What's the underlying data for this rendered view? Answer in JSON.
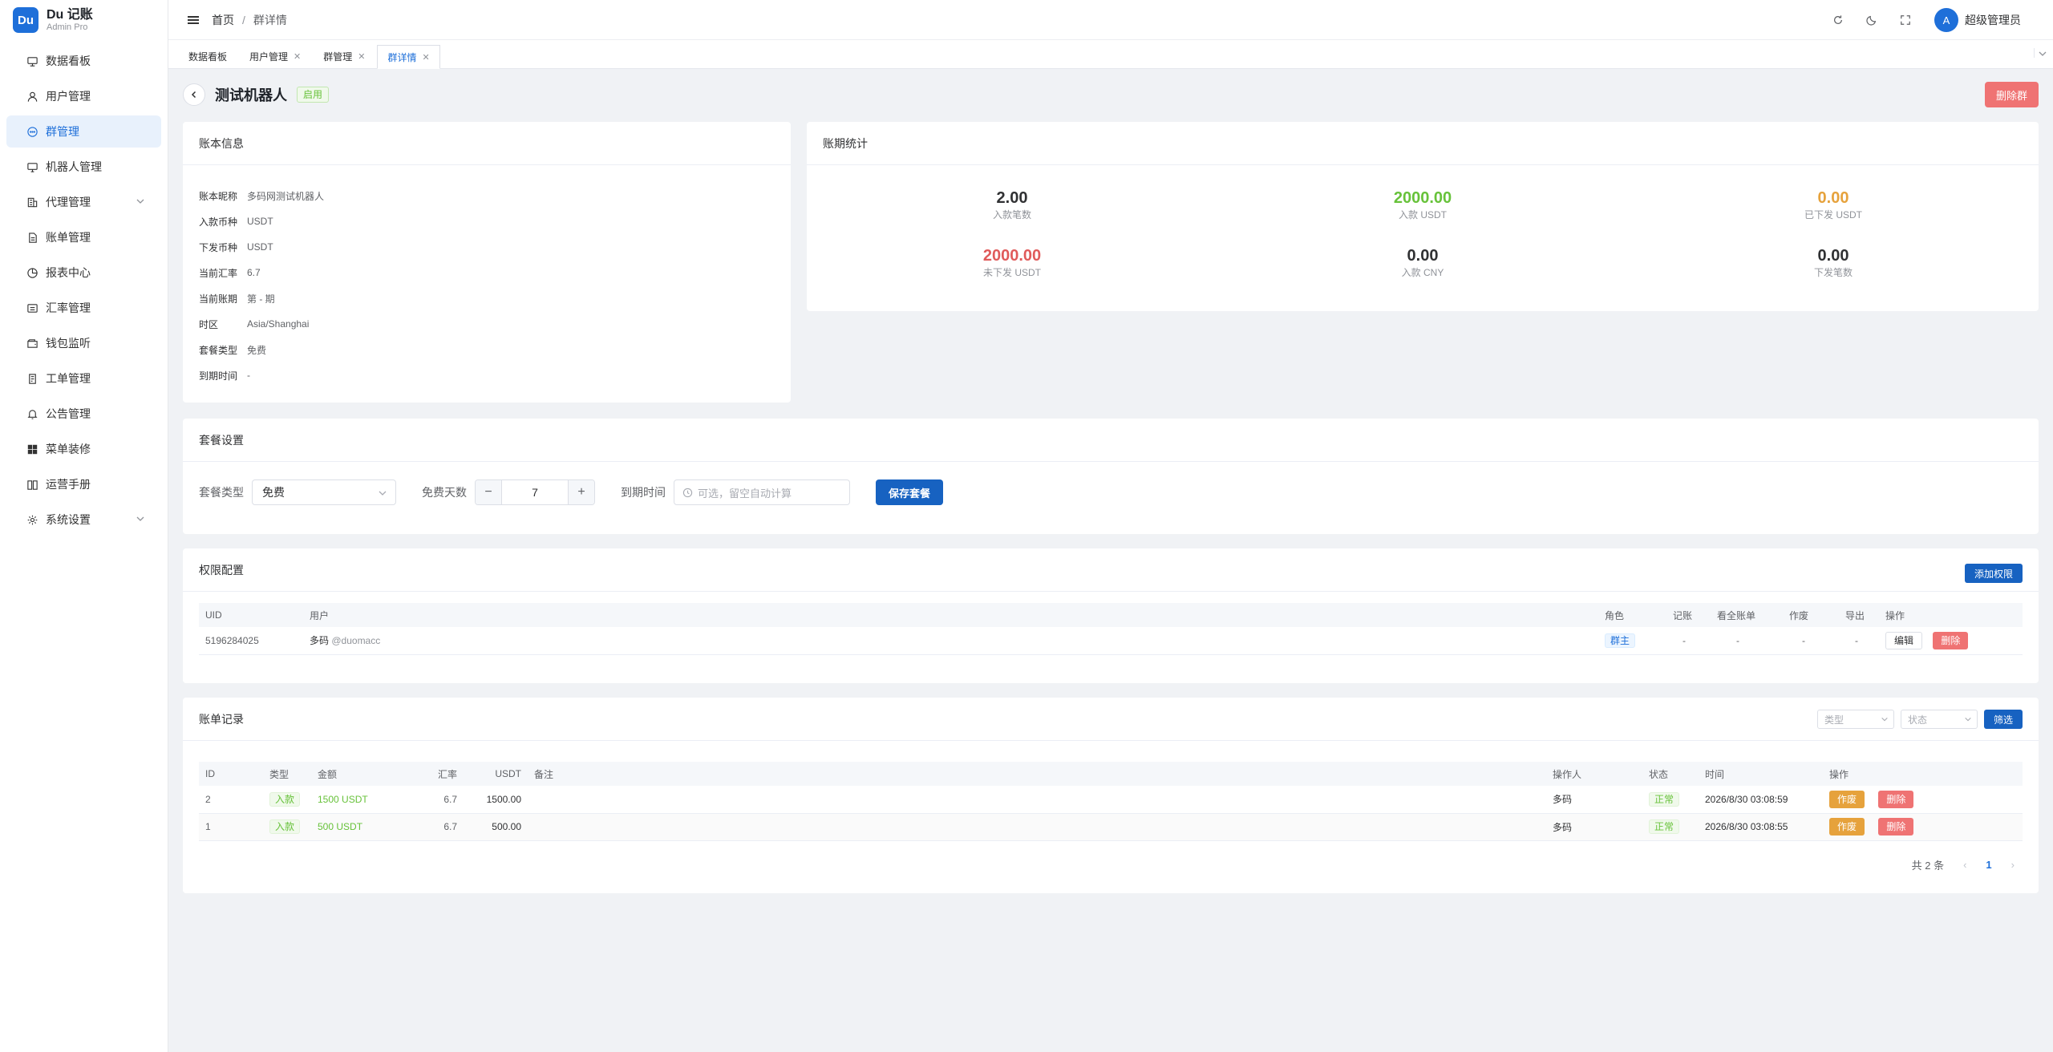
{
  "brand": {
    "logo": "Du",
    "name": "Du 记账",
    "sub": "Admin Pro"
  },
  "sidebar": {
    "items": [
      {
        "label": "数据看板",
        "icon": "dashboard-icon"
      },
      {
        "label": "用户管理",
        "icon": "user-icon"
      },
      {
        "label": "群管理",
        "icon": "chat-icon",
        "active": true
      },
      {
        "label": "机器人管理",
        "icon": "monitor-icon"
      },
      {
        "label": "代理管理",
        "icon": "building-icon",
        "expandable": true
      },
      {
        "label": "账单管理",
        "icon": "document-icon"
      },
      {
        "label": "报表中心",
        "icon": "pie-chart-icon"
      },
      {
        "label": "汇率管理",
        "icon": "exchange-icon"
      },
      {
        "label": "钱包监听",
        "icon": "wallet-icon"
      },
      {
        "label": "工单管理",
        "icon": "ticket-icon"
      },
      {
        "label": "公告管理",
        "icon": "bell-icon"
      },
      {
        "label": "菜单装修",
        "icon": "grid-icon"
      },
      {
        "label": "运营手册",
        "icon": "book-icon"
      },
      {
        "label": "系统设置",
        "icon": "gear-icon",
        "expandable": true
      }
    ]
  },
  "header": {
    "breadcrumb_home": "首页",
    "breadcrumb_sep": "/",
    "breadcrumb_current": "群详情",
    "avatar_letter": "A",
    "username": "超级管理员"
  },
  "tabs": [
    {
      "label": "数据看板",
      "closable": false
    },
    {
      "label": "用户管理",
      "closable": true
    },
    {
      "label": "群管理",
      "closable": true
    },
    {
      "label": "群详情",
      "closable": true,
      "active": true
    }
  ],
  "page": {
    "title": "测试机器人",
    "status": "启用",
    "delete_group": "删除群"
  },
  "account_info": {
    "title": "账本信息",
    "rows": [
      {
        "k": "账本昵称",
        "v": "多码网测试机器人"
      },
      {
        "k": "入款币种",
        "v": "USDT"
      },
      {
        "k": "下发币种",
        "v": "USDT"
      },
      {
        "k": "当前汇率",
        "v": "6.7"
      },
      {
        "k": "当前账期",
        "v": "第 - 期"
      },
      {
        "k": "时区",
        "v": "Asia/Shanghai"
      },
      {
        "k": "套餐类型",
        "v": "免费"
      },
      {
        "k": "到期时间",
        "v": "-"
      }
    ]
  },
  "stats": {
    "title": "账期统计",
    "items": [
      {
        "value": "2.00",
        "label": "入款笔数",
        "color": "#303133"
      },
      {
        "value": "2000.00",
        "label": "入款 USDT",
        "color": "#67c23a"
      },
      {
        "value": "0.00",
        "label": "已下发 USDT",
        "color": "#e6a23c"
      },
      {
        "value": "2000.00",
        "label": "未下发 USDT",
        "color": "#e05a5a"
      },
      {
        "value": "0.00",
        "label": "入款 CNY",
        "color": "#303133"
      },
      {
        "value": "0.00",
        "label": "下发笔数",
        "color": "#303133"
      }
    ]
  },
  "plan": {
    "title": "套餐设置",
    "type_label": "套餐类型",
    "type_value": "免费",
    "days_label": "免费天数",
    "days_value": "7",
    "minus": "−",
    "plus": "+",
    "expire_label": "到期时间",
    "expire_placeholder": "可选，留空自动计算",
    "save": "保存套餐"
  },
  "permissions": {
    "title": "权限配置",
    "add": "添加权限",
    "columns": [
      "UID",
      "用户",
      "角色",
      "记账",
      "看全账单",
      "作废",
      "导出",
      "操作"
    ],
    "rows": [
      {
        "uid": "5196284025",
        "user": "多码",
        "handle": "@duomacc",
        "role": "群主",
        "book": "-",
        "view_all": "-",
        "void": "-",
        "export": "-",
        "edit": "编辑",
        "delete": "删除"
      }
    ]
  },
  "records": {
    "title": "账单记录",
    "filter_type": "类型",
    "filter_status": "状态",
    "filter_btn": "筛选",
    "columns": [
      "ID",
      "类型",
      "金额",
      "汇率",
      "USDT",
      "备注",
      "操作人",
      "状态",
      "时间",
      "操作"
    ],
    "rows": [
      {
        "id": "2",
        "type": "入款",
        "amount": "1500 USDT",
        "rate": "6.7",
        "usdt": "1500.00",
        "note": "",
        "operator": "多码",
        "status": "正常",
        "time": "2026/8/30 03:08:59",
        "void": "作废",
        "delete": "删除"
      },
      {
        "id": "1",
        "type": "入款",
        "amount": "500 USDT",
        "rate": "6.7",
        "usdt": "500.00",
        "note": "",
        "operator": "多码",
        "status": "正常",
        "time": "2026/8/30 03:08:55",
        "void": "作废",
        "delete": "删除"
      }
    ],
    "total": "共 2 条",
    "page": "1",
    "prev": "‹",
    "next": "›"
  }
}
